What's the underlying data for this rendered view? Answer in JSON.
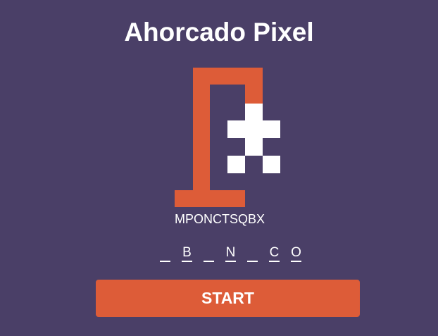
{
  "game": {
    "title": "Ahorcado Pixel",
    "used_letters": "MPONCTSQBX",
    "word": [
      "",
      "B",
      "",
      "N",
      "",
      "C",
      "O"
    ],
    "start_label": "START",
    "accent_color": "#dd5c38",
    "background_color": "#4a3f67"
  }
}
